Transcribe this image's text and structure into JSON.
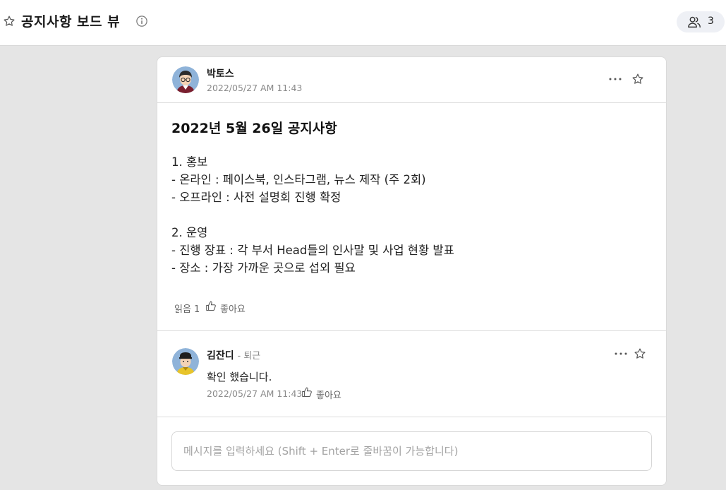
{
  "header": {
    "title": "공지사항 보드 뷰",
    "member_count": "3"
  },
  "post": {
    "author": "박토스",
    "timestamp": "2022/05/27 AM 11:43",
    "title": "2022년 5월 26일 공지사항",
    "lines": [
      "1. 홍보",
      "- 온라인 : 페이스북, 인스타그램, 뉴스 제작 (주 2회)",
      "- 오프라인 : 사전 설명회 진행 확정",
      "2. 운영",
      "- 진행 장표 : 각 부서 Head들의 인사말 및 사업 현황 발표",
      "- 장소 : 가장 가까운 곳으로 섭외 필요"
    ],
    "read_label": "읽음 1",
    "like_label": "좋아요"
  },
  "comment": {
    "author": "김잔디",
    "status": "- 퇴근",
    "text": "확인 했습니다.",
    "timestamp": "2022/05/27 AM 11:43",
    "like_label": "좋아요"
  },
  "composer": {
    "placeholder": "메시지를 입력하세요 (Shift + Enter로 줄바꿈이 가능합니다)"
  },
  "icons": {
    "favorite": "star-outline-icon",
    "info": "info-icon",
    "members": "users-icon",
    "more": "more-horizontal-icon",
    "like": "thumbs-up-icon"
  },
  "colors": {
    "background": "#e5e5e5",
    "card": "#ffffff",
    "members_pill": "#eef0f5"
  }
}
